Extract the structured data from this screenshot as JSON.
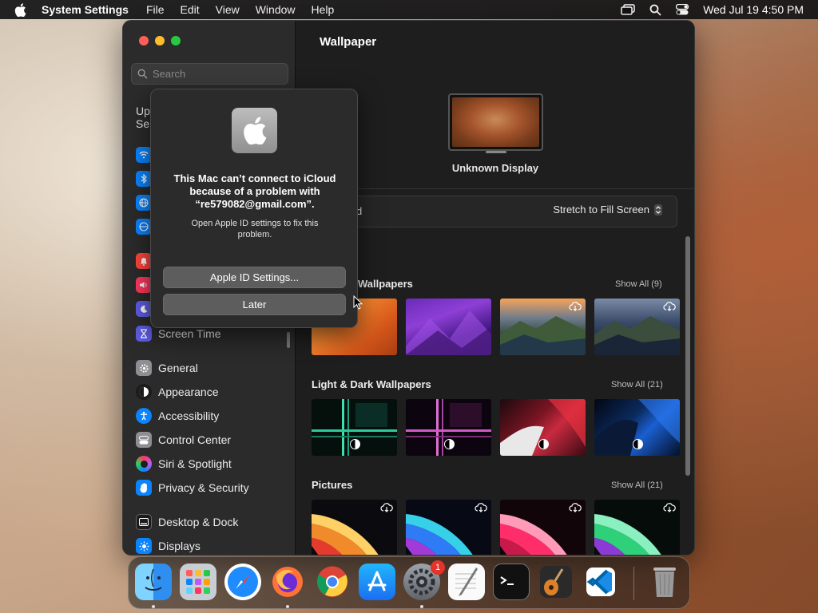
{
  "menubar": {
    "app_name": "System Settings",
    "items": [
      "File",
      "Edit",
      "View",
      "Window",
      "Help"
    ],
    "datetime": "Wed Jul 19  4:50 PM"
  },
  "sidebar": {
    "search_placeholder": "Search",
    "partial_text_1": "Up",
    "partial_text_2": "Se",
    "items": [
      {
        "label": "Screen Time",
        "icon": "hourglass-icon",
        "color": "#5e5ce6"
      },
      {
        "label": "General",
        "icon": "gear-icon",
        "color": "#8e8e93"
      },
      {
        "label": "Appearance",
        "icon": "appearance-icon",
        "color": "#1c1c1e"
      },
      {
        "label": "Accessibility",
        "icon": "accessibility-icon",
        "color": "#0a84ff"
      },
      {
        "label": "Control Center",
        "icon": "control-center-icon",
        "color": "#8e8e93"
      },
      {
        "label": "Siri & Spotlight",
        "icon": "siri-icon",
        "color": "#bf5af2"
      },
      {
        "label": "Privacy & Security",
        "icon": "hand-icon",
        "color": "#0a84ff"
      },
      {
        "label": "Desktop & Dock",
        "icon": "dock-icon",
        "color": "#1c1c1e"
      },
      {
        "label": "Displays",
        "icon": "sun-icon",
        "color": "#0a84ff"
      }
    ]
  },
  "main": {
    "title": "Wallpaper",
    "display_name": "Unknown Display",
    "fill_label_partial": "d",
    "fill_option": "Stretch to Fill Screen",
    "sections": [
      {
        "title_partial": "Wallpapers",
        "show_all": "Show All (9)"
      },
      {
        "title": "Light & Dark Wallpapers",
        "show_all": "Show All (21)"
      },
      {
        "title": "Pictures",
        "show_all": "Show All (21)"
      }
    ]
  },
  "dialog": {
    "title": "This Mac can’t connect to iCloud because of a problem with “re579082@gmail.com”.",
    "message": "Open Apple ID settings to fix this problem.",
    "primary_button": "Apple ID Settings...",
    "secondary_button": "Later"
  },
  "dock": {
    "items": [
      "Finder",
      "Launchpad",
      "Safari",
      "Firefox",
      "Chrome",
      "App Store",
      "System Settings",
      "TextEdit",
      "Terminal",
      "GarageBand",
      "Visual Studio Code",
      "Trash"
    ],
    "settings_badge": "1"
  }
}
